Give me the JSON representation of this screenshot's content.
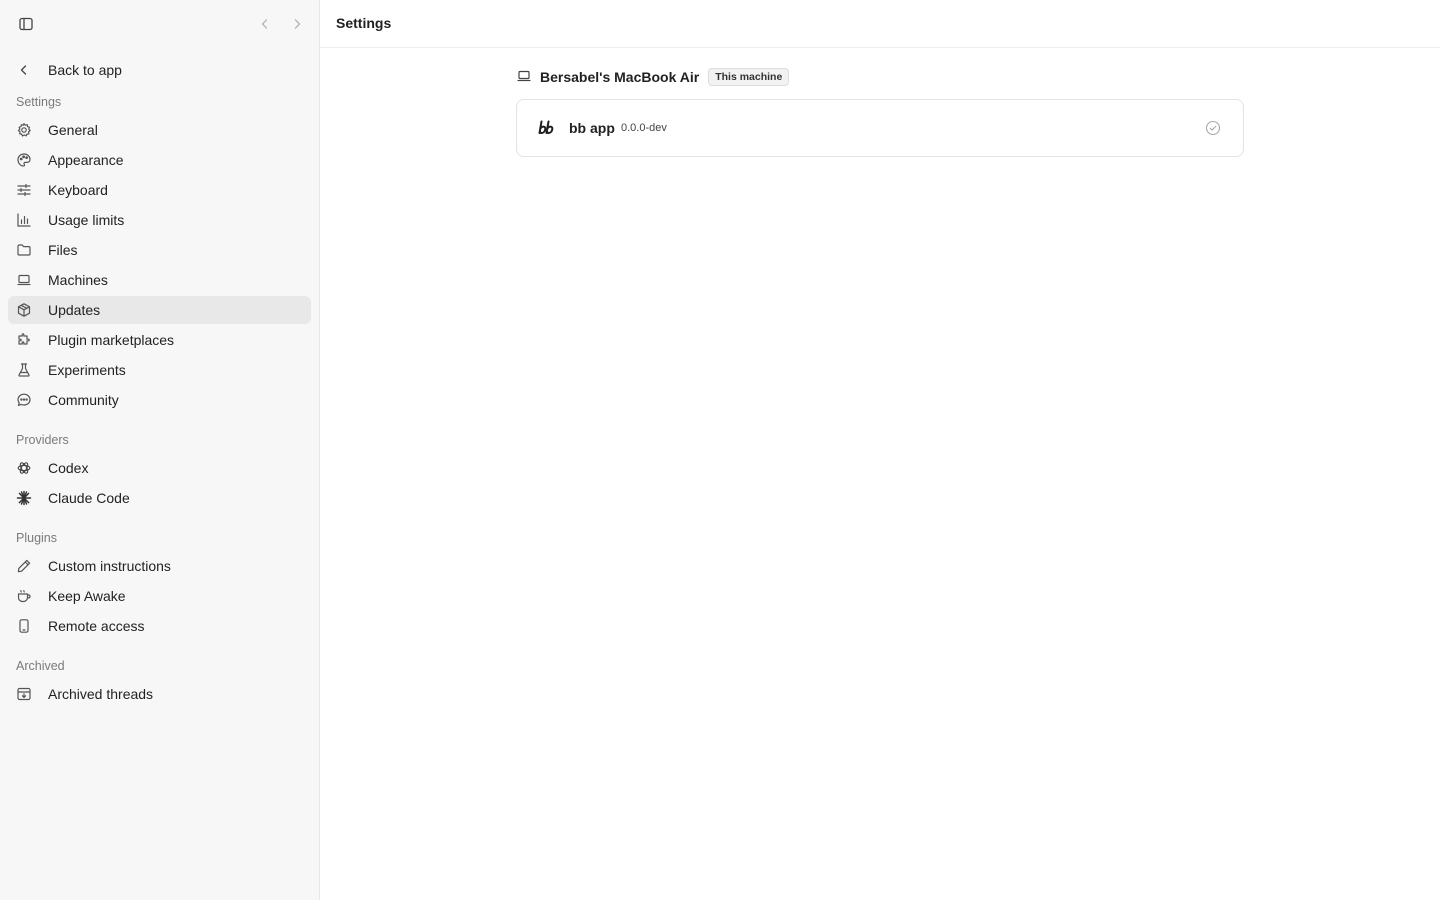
{
  "sidebar": {
    "back_label": "Back to app",
    "sections": {
      "settings": "Settings",
      "providers": "Providers",
      "plugins": "Plugins",
      "archived": "Archived"
    },
    "items": {
      "general": "General",
      "appearance": "Appearance",
      "keyboard": "Keyboard",
      "usage_limits": "Usage limits",
      "files": "Files",
      "machines": "Machines",
      "updates": "Updates",
      "plugin_marketplaces": "Plugin marketplaces",
      "experiments": "Experiments",
      "community": "Community",
      "codex": "Codex",
      "claude_code": "Claude Code",
      "custom_instructions": "Custom instructions",
      "keep_awake": "Keep Awake",
      "remote_access": "Remote access",
      "archived_threads": "Archived threads"
    },
    "active_item": "updates"
  },
  "main": {
    "title": "Settings",
    "machine": {
      "name": "Bersabel's MacBook Air",
      "badge": "This machine"
    },
    "app": {
      "name": "bb app",
      "version": "0.0.0-dev",
      "status": "up-to-date"
    }
  },
  "icons": {
    "sidebar_toggle": "sidebar-toggle-icon",
    "back": "chevron-left-icon",
    "forward": "chevron-right-icon",
    "machine": "laptop-icon",
    "app_status": "check-circle-icon"
  },
  "colors": {
    "sidebar_bg": "#f7f7f7",
    "active_bg": "#e8e8e8",
    "text": "#1f1f1f",
    "muted": "#7a7a7a"
  }
}
